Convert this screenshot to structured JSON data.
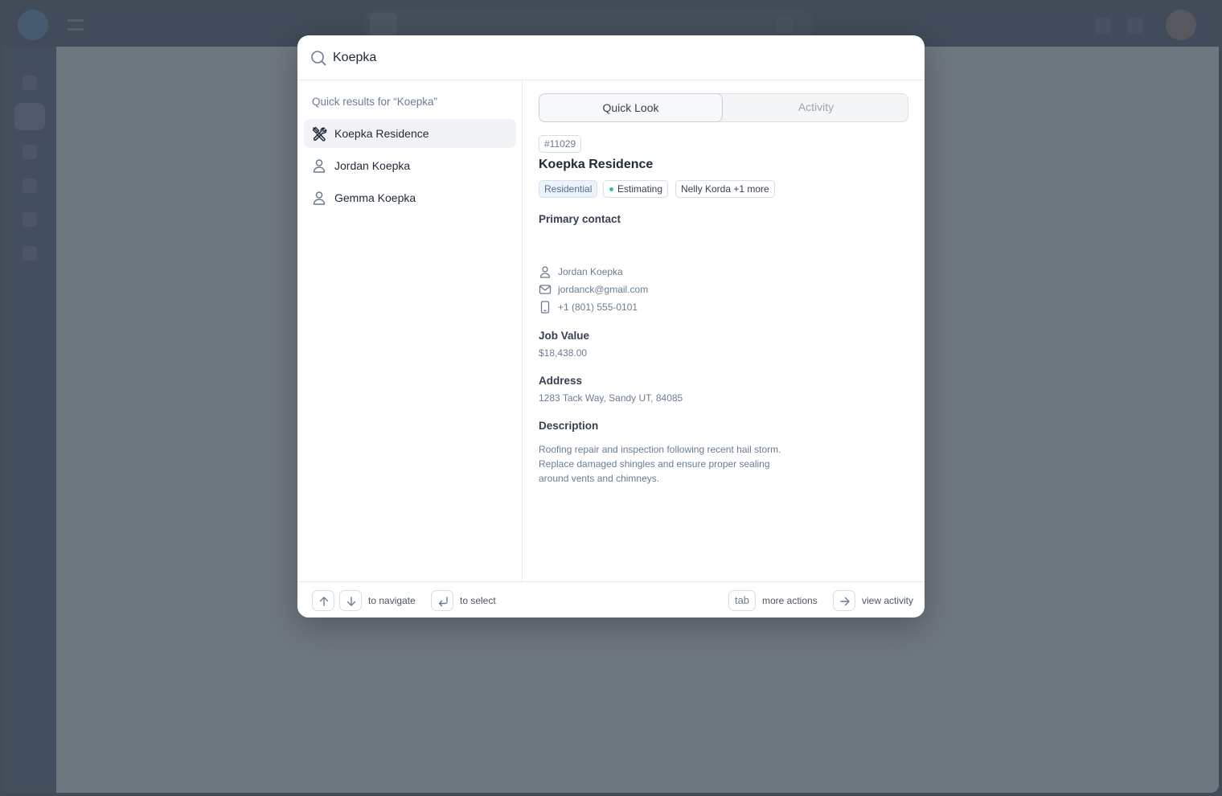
{
  "search": {
    "query": "Koepka"
  },
  "results": {
    "title": "Quick results for “Koepka”",
    "items": [
      {
        "label": "Koepka Residence",
        "icon": "tools-icon",
        "active": true
      },
      {
        "label": "Jordan Koepka",
        "icon": "user-icon",
        "active": false
      },
      {
        "label": "Gemma Koepka",
        "icon": "user-icon",
        "active": false
      }
    ]
  },
  "preview": {
    "tabs": [
      {
        "label": "Quick Look",
        "active": true
      },
      {
        "label": "Activity",
        "active": false
      }
    ],
    "job_id": "#11029",
    "title": "Koepka Residence",
    "tags": {
      "type": "Residential",
      "status": "Estimating",
      "status_color": "#35c48a",
      "people": "Nelly Korda +1 more"
    },
    "primary_contact": {
      "label": "Primary contact",
      "name": "Jordan Koepka",
      "email": "jordanck@gmail.com",
      "phone": "+1 (801) 555-0101"
    },
    "job_value": {
      "label": "Job Value",
      "value": "$18,438.00"
    },
    "address": {
      "label": "Address",
      "value": "1283 Tack Way, Sandy UT, 84085"
    },
    "description": {
      "label": "Description",
      "lines": [
        "Roofing repair and inspection following recent hail storm.",
        "Replace damaged shingles and ensure proper sealing",
        "around vents and chimneys."
      ]
    }
  },
  "footer": {
    "navigate_label": "to navigate",
    "select_label": "to select",
    "tab_key": "tab",
    "more_actions_label": "more actions",
    "view_activity_label": "view activity"
  },
  "colors": {
    "overlay": "#4b5560",
    "accent_text": "#6a7d93",
    "status_dot": "#35c48a",
    "tag_blue_bg": "#eef3fb"
  }
}
